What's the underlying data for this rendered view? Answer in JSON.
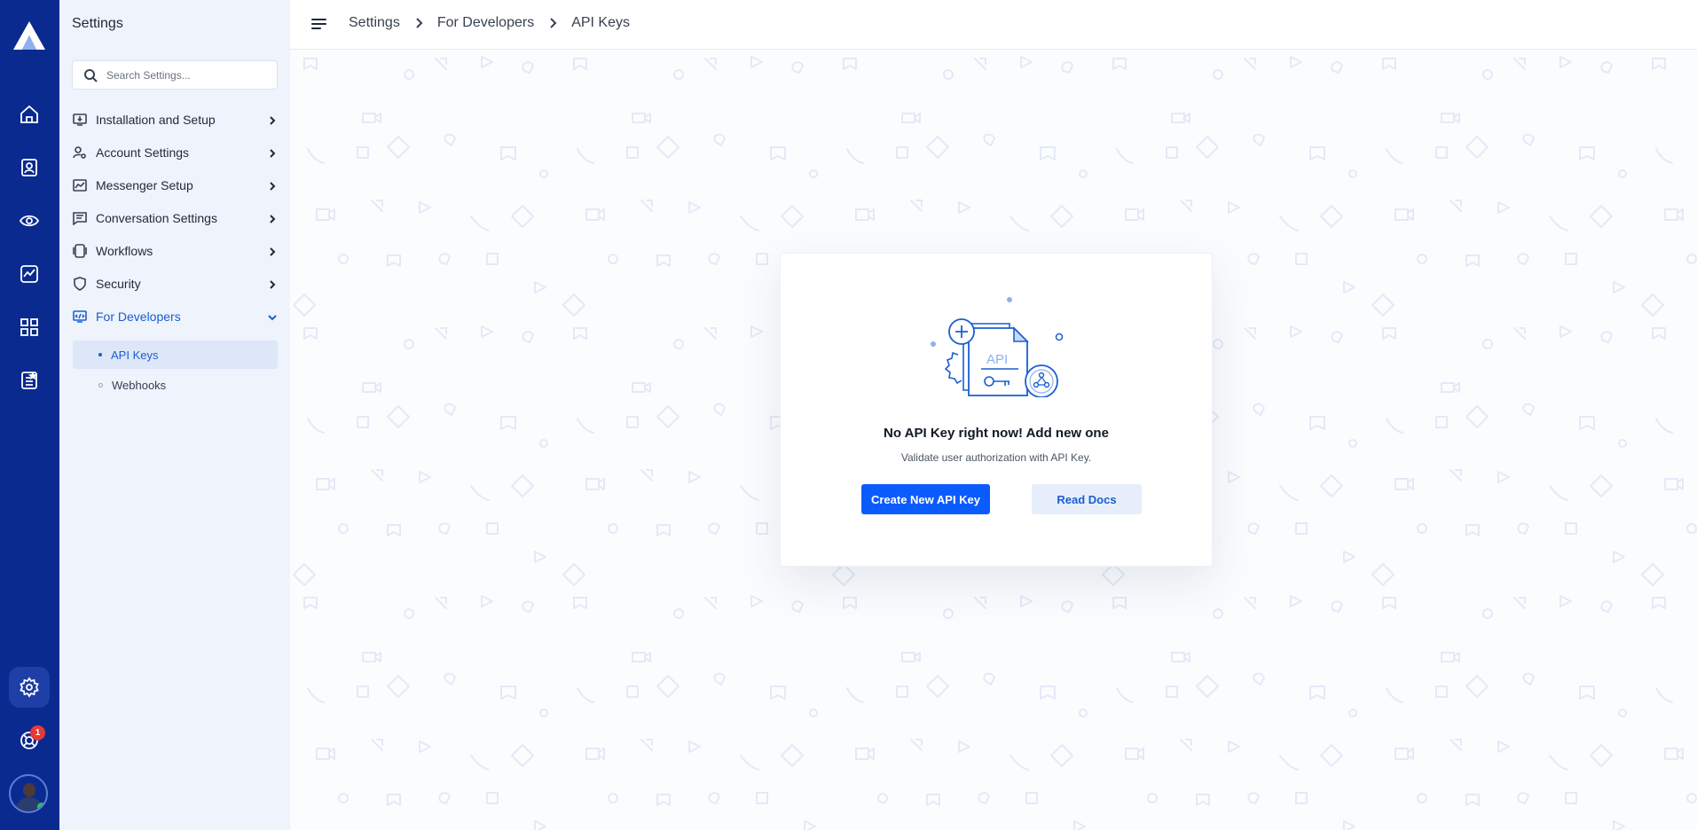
{
  "app": {
    "rail_icons": [
      "home-icon",
      "contacts-icon",
      "eye-icon",
      "analytics-icon",
      "apps-icon",
      "reports-icon"
    ],
    "active_rail": "settings-icon",
    "support_badge": "1"
  },
  "sidebar": {
    "title": "Settings",
    "search_placeholder": "Search Settings...",
    "items": [
      {
        "label": "Installation and Setup",
        "icon": "monitor-download-icon"
      },
      {
        "label": "Account Settings",
        "icon": "user-gear-icon"
      },
      {
        "label": "Messenger Setup",
        "icon": "chart-window-icon"
      },
      {
        "label": "Conversation Settings",
        "icon": "chat-lines-icon"
      },
      {
        "label": "Workflows",
        "icon": "workflow-icon"
      },
      {
        "label": "Security",
        "icon": "shield-icon"
      },
      {
        "label": "For Developers",
        "icon": "code-window-icon"
      }
    ],
    "sub_items": [
      {
        "label": "API Keys"
      },
      {
        "label": "Webhooks"
      }
    ]
  },
  "breadcrumb": {
    "items": [
      "Settings",
      "For Developers",
      "API Keys"
    ]
  },
  "empty_state": {
    "illustration_text": "API",
    "title": "No API Key right now! Add new one",
    "subtitle": "Validate user authorization with API Key.",
    "primary_button": "Create New API Key",
    "secondary_button": "Read Docs"
  },
  "colors": {
    "rail_bg": "#0a2a8f",
    "accent": "#0b5cff",
    "active_text": "#1a5fd0",
    "sidebar_bg": "#eef3fc"
  }
}
